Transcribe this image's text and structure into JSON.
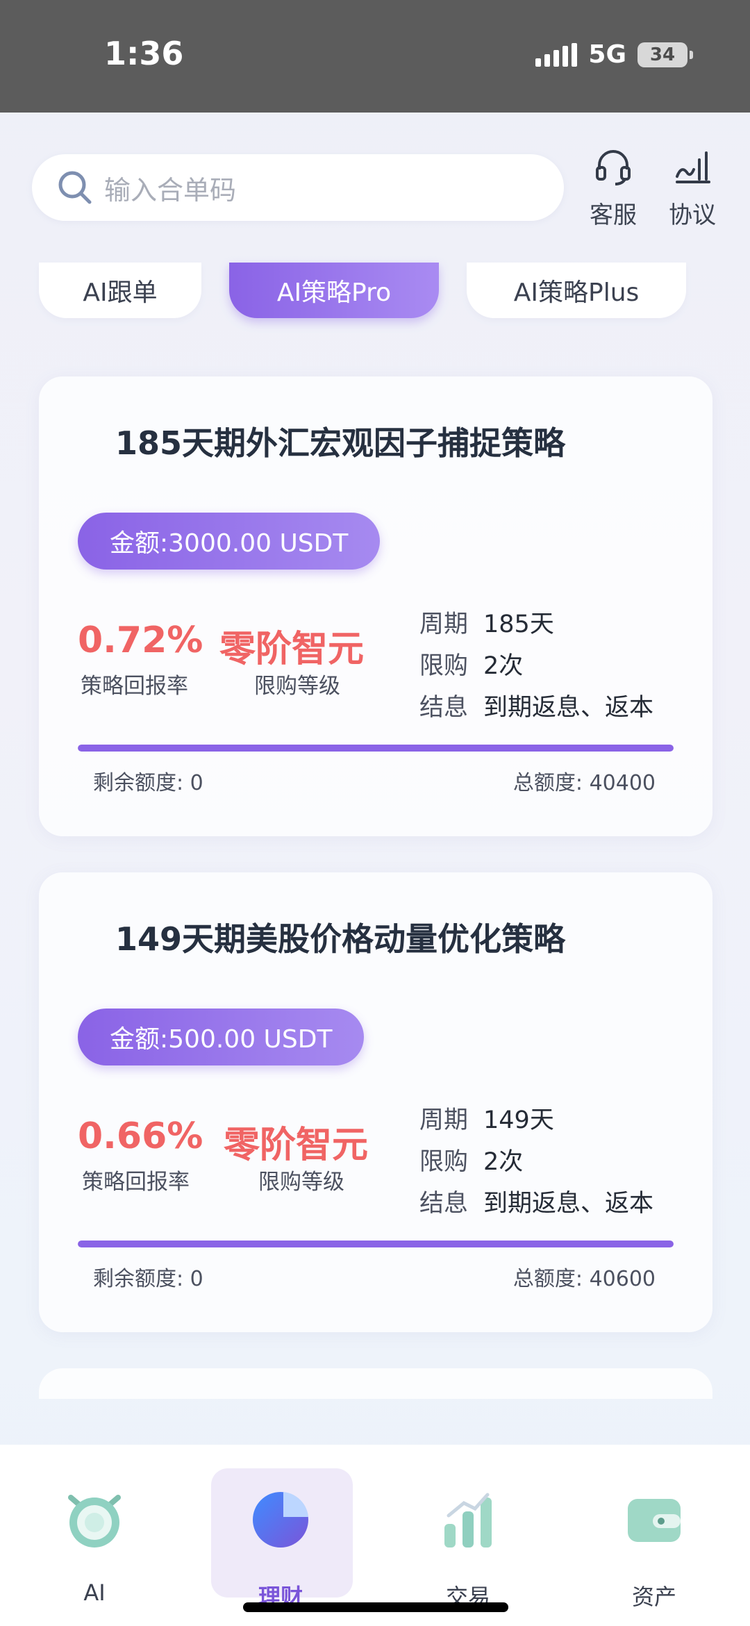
{
  "status_bar": {
    "time": "1:36",
    "network": "5G",
    "battery": "34"
  },
  "header": {
    "search_placeholder": "输入合单码",
    "service_label": "客服",
    "agreement_label": "协议"
  },
  "tabs": [
    {
      "label": "AI跟单"
    },
    {
      "label": "AI策略Pro"
    },
    {
      "label": "AI策略Plus"
    }
  ],
  "cards": [
    {
      "title": "185天期外汇宏观因子捕捉策略",
      "amount": "金额:3000.00 USDT",
      "rate": "0.72%",
      "rate_label": "策略回报率",
      "level": "零阶智元",
      "level_label": "限购等级",
      "period_key": "周期",
      "period_val": "185天",
      "limit_key": "限购",
      "limit_val": "2次",
      "settle_key": "结息",
      "settle_val": "到期返息、返本",
      "progress": 1.0,
      "remaining": "剩余额度: 0",
      "total": "总额度: 40400"
    },
    {
      "title": "149天期美股价格动量优化策略",
      "amount": "金额:500.00 USDT",
      "rate": "0.66%",
      "rate_label": "策略回报率",
      "level": "零阶智元",
      "level_label": "限购等级",
      "period_key": "周期",
      "period_val": "149天",
      "limit_key": "限购",
      "limit_val": "2次",
      "settle_key": "结息",
      "settle_val": "到期返息、返本",
      "progress": 1.0,
      "remaining": "剩余额度: 0",
      "total": "总额度: 40600"
    }
  ],
  "nav": [
    {
      "label": "AI",
      "icon": "ai-robot-icon"
    },
    {
      "label": "理财",
      "icon": "pie-chart-icon"
    },
    {
      "label": "交易",
      "icon": "bar-chart-icon"
    },
    {
      "label": "资产",
      "icon": "wallet-icon"
    }
  ],
  "colors": {
    "accent": "#8a63e6",
    "rate_red": "#f06464"
  }
}
